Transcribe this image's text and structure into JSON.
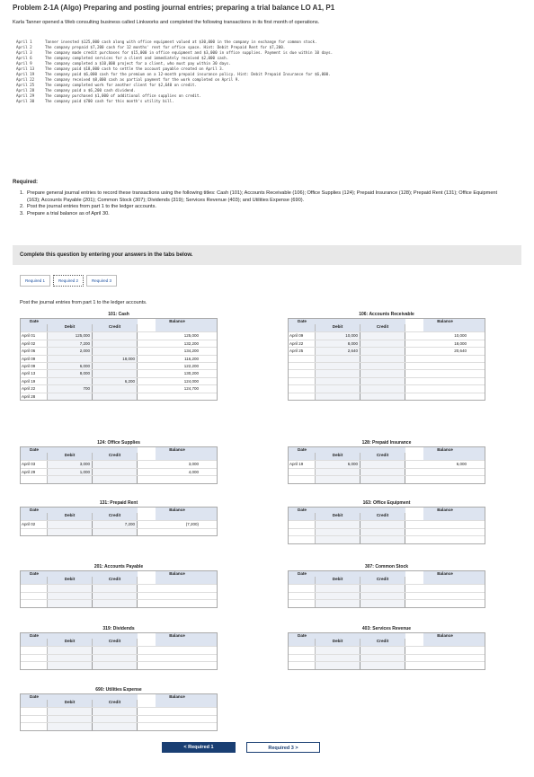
{
  "title": "Problem 2-1A (Algo) Preparing and posting journal entries; preparing a trial balance LO A1, P1",
  "intro": "Karla Tanner opened a Web consulting business called Linkworks and completed the following transactions in its first month of operations.",
  "events": [
    {
      "date": "April 1",
      "text": "Tanner invested $125,000 cash along with office equipment valued at $30,000 in the company in exchange for common stock."
    },
    {
      "date": "April 2",
      "text": "The company prepaid $7,200 cash for 12 months' rent for office space. Hint: Debit Prepaid Rent for $7,200."
    },
    {
      "date": "April 3",
      "text": "The company made credit purchases for $15,000 in office equipment and $3,000 in office supplies. Payment is due within 10 days."
    },
    {
      "date": "April 6",
      "text": "The company completed services for a client and immediately received $2,000 cash."
    },
    {
      "date": "April 9",
      "text": "The company completed a $10,000 project for a client, who must pay within 30 days."
    },
    {
      "date": "April 13",
      "text": "The company paid $18,000 cash to settle the account payable created on April 3."
    },
    {
      "date": "April 19",
      "text": "The company paid $6,000 cash for the premium on a 12-month prepaid insurance policy. Hint: Debit Prepaid Insurance for $6,000."
    },
    {
      "date": "April 22",
      "text": "The company received $8,000 cash as partial payment for the work completed on April 9."
    },
    {
      "date": "April 25",
      "text": "The company completed work for another client for $2,640 on credit."
    },
    {
      "date": "April 28",
      "text": "The company paid a $6,200 cash dividend."
    },
    {
      "date": "April 29",
      "text": "The company purchased $1,000 of additional office supplies on credit."
    },
    {
      "date": "April 30",
      "text": "The company paid $700 cash for this month's utility bill."
    }
  ],
  "required_heading": "Required:",
  "required": [
    {
      "n": "1.",
      "text": "Prepare general journal entries to record these transactions using the following titles: Cash (101); Accounts Receivable (106); Office Supplies (124); Prepaid Insurance (128); Prepaid Rent (131); Office Equipment (163); Accounts Payable (201); Common Stock (307); Dividends (319); Services Revenue (403); and Utilities Expense (690)."
    },
    {
      "n": "2.",
      "text": "Post the journal entries from part 1 to the ledger accounts."
    },
    {
      "n": "3.",
      "text": "Prepare a trial balance as of April 30."
    }
  ],
  "banner": "Complete this question by entering your answers in the tabs below.",
  "tabs": [
    "Required 1",
    "Required 2",
    "Required 3"
  ],
  "instruction": "Post the journal entries from part 1 to the ledger accounts.",
  "headers": {
    "date": "Date",
    "debit": "Debit",
    "credit": "Credit",
    "balance": "Balance"
  },
  "ledgers": {
    "cash": {
      "title": "101: Cash",
      "rows": [
        {
          "date": "April 01",
          "debit": "125,000",
          "credit": "",
          "balance": "125,000"
        },
        {
          "date": "April 02",
          "debit": "7,200",
          "credit": "",
          "balance": "132,200"
        },
        {
          "date": "April 06",
          "debit": "2,000",
          "credit": "",
          "balance": "134,200"
        },
        {
          "date": "April 09",
          "debit": "",
          "credit": "18,000",
          "balance": "116,200"
        },
        {
          "date": "April 09",
          "debit": "6,000",
          "credit": "",
          "balance": "122,200"
        },
        {
          "date": "April 13",
          "debit": "8,000",
          "credit": "",
          "balance": "130,200"
        },
        {
          "date": "April 19",
          "debit": "",
          "credit": "6,200",
          "balance": "124,000"
        },
        {
          "date": "April 22",
          "debit": "700",
          "credit": "",
          "balance": "124,700"
        },
        {
          "date": "April 28",
          "debit": "",
          "credit": "",
          "balance": ""
        }
      ]
    },
    "ar": {
      "title": "106: Accounts Receivable",
      "rows": [
        {
          "date": "April 09",
          "debit": "10,000",
          "credit": "",
          "balance": "10,000"
        },
        {
          "date": "April 22",
          "debit": "8,000",
          "credit": "",
          "balance": "18,000"
        },
        {
          "date": "April 25",
          "debit": "2,640",
          "credit": "",
          "balance": "20,640"
        }
      ]
    },
    "supplies": {
      "title": "124: Office Supplies",
      "rows": [
        {
          "date": "April 03",
          "debit": "3,000",
          "credit": "",
          "balance": "3,000"
        },
        {
          "date": "April 29",
          "debit": "1,000",
          "credit": "",
          "balance": "4,000"
        }
      ]
    },
    "insurance": {
      "title": "128: Prepaid Insurance",
      "rows": [
        {
          "date": "April 19",
          "debit": "6,000",
          "credit": "",
          "balance": "6,000"
        }
      ]
    },
    "rent": {
      "title": "131: Prepaid Rent",
      "rows": [
        {
          "date": "April 02",
          "debit": "",
          "credit": "7,200",
          "balance": "(7,200)"
        }
      ]
    },
    "equipment": {
      "title": "163: Office Equipment",
      "rows": []
    },
    "ap": {
      "title": "201: Accounts Payable",
      "rows": []
    },
    "stock": {
      "title": "307: Common Stock",
      "rows": []
    },
    "dividends": {
      "title": "319: Dividends",
      "rows": []
    },
    "revenue": {
      "title": "403: Services Revenue",
      "rows": []
    },
    "utilities": {
      "title": "690: Utilities Expense",
      "rows": []
    }
  },
  "nav": {
    "prev": "< Required 1",
    "next": "Required 3 >"
  }
}
